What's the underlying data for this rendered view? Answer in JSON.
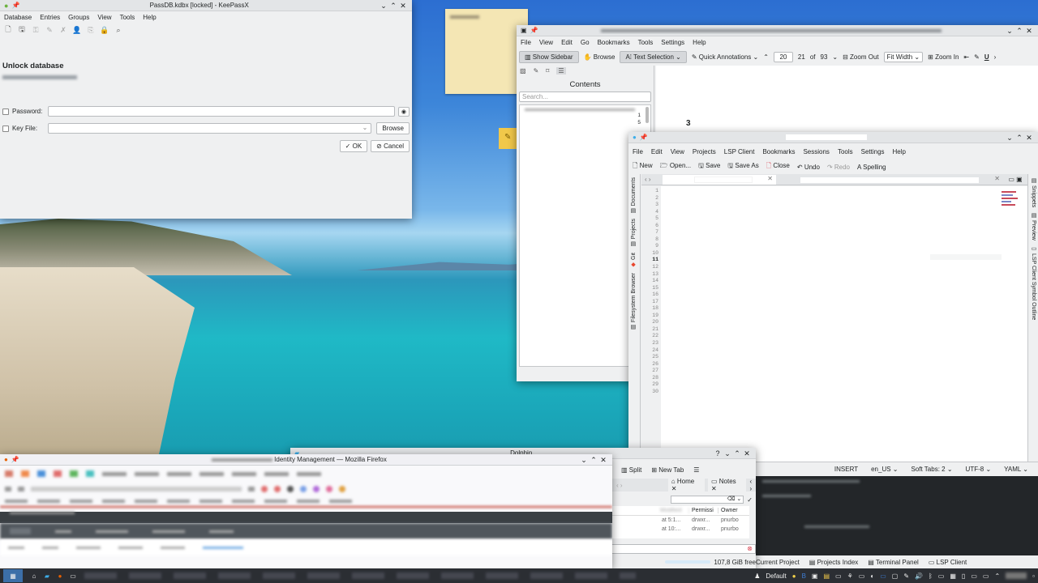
{
  "keepassx": {
    "title": "PassDB.kdbx [locked] - KeePassX",
    "menu": [
      "Database",
      "Entries",
      "Groups",
      "View",
      "Tools",
      "Help"
    ],
    "heading": "Unlock database",
    "password_label": "Password:",
    "keyfile_label": "Key File:",
    "browse": "Browse",
    "ok": "OK",
    "cancel": "Cancel"
  },
  "okular": {
    "menu": [
      "File",
      "View",
      "Edit",
      "Go",
      "Bookmarks",
      "Tools",
      "Settings",
      "Help"
    ],
    "show_sidebar": "Show Sidebar",
    "browse": "Browse",
    "text_selection": "Text Selection",
    "quick_annotations": "Quick Annotations",
    "zoom_value": "20",
    "page_current": "21",
    "page_of": "of",
    "page_total": "93",
    "zoom_out": "Zoom Out",
    "fit_width": "Fit Width",
    "zoom_in": "Zoom In",
    "contents": "Contents",
    "search_placeholder": "Search...",
    "toc_pages": [
      "1",
      "5"
    ],
    "page_text": "3"
  },
  "kate": {
    "menu": [
      "File",
      "Edit",
      "View",
      "Projects",
      "LSP Client",
      "Bookmarks",
      "Sessions",
      "Tools",
      "Settings",
      "Help"
    ],
    "toolbar": {
      "new": "New",
      "open": "Open...",
      "save": "Save",
      "save_as": "Save As",
      "close": "Close",
      "undo": "Undo",
      "redo": "Redo",
      "spelling": "Spelling"
    },
    "left_tabs": [
      "Documents",
      "Projects",
      "Git",
      "Filesystem Browser"
    ],
    "right_tabs": [
      "Snippets",
      "Preview",
      "LSP Client Symbol Outline"
    ],
    "lines": [
      "1",
      "2",
      "3",
      "4",
      "5",
      "6",
      "7",
      "8",
      "9",
      "10",
      "11",
      "12",
      "13",
      "14",
      "15",
      "16",
      "17",
      "18",
      "19",
      "20",
      "21",
      "22",
      "23",
      "24",
      "25",
      "26",
      "27",
      "28",
      "29",
      "30"
    ],
    "current_line": "11",
    "status": {
      "mode": "INSERT",
      "lang": "en_US",
      "tabs": "Soft Tabs: 2",
      "encoding": "UTF-8",
      "syntax": "YAML"
    },
    "bottom_tabs": [
      "Current Project",
      "Projects Index",
      "Terminal Panel",
      "LSP Client"
    ]
  },
  "dolphin": {
    "title_part": "Dolphin",
    "split": "Split",
    "new_tab": "New Tab",
    "tabs": [
      "Home",
      "Notes"
    ],
    "columns": [
      "Permissi",
      "Owner"
    ],
    "rows": [
      {
        "modified": "at 5:1...",
        "perm": "drwxr...",
        "owner": "pnurbo"
      },
      {
        "modified": "at 10:...",
        "perm": "drwxr...",
        "owner": "pnurbo"
      }
    ],
    "free_space": "107,8 GiB free"
  },
  "firefox": {
    "title": "Identity Management — Mozilla Firefox"
  },
  "taskbar": {
    "kb_layout": "Default"
  },
  "colors": {
    "accent": "#3daee9",
    "window_bg": "#eff0f1",
    "taskbar": "#2b2e33",
    "terminal": "#232629",
    "firefox_accent": "#c0392b"
  }
}
